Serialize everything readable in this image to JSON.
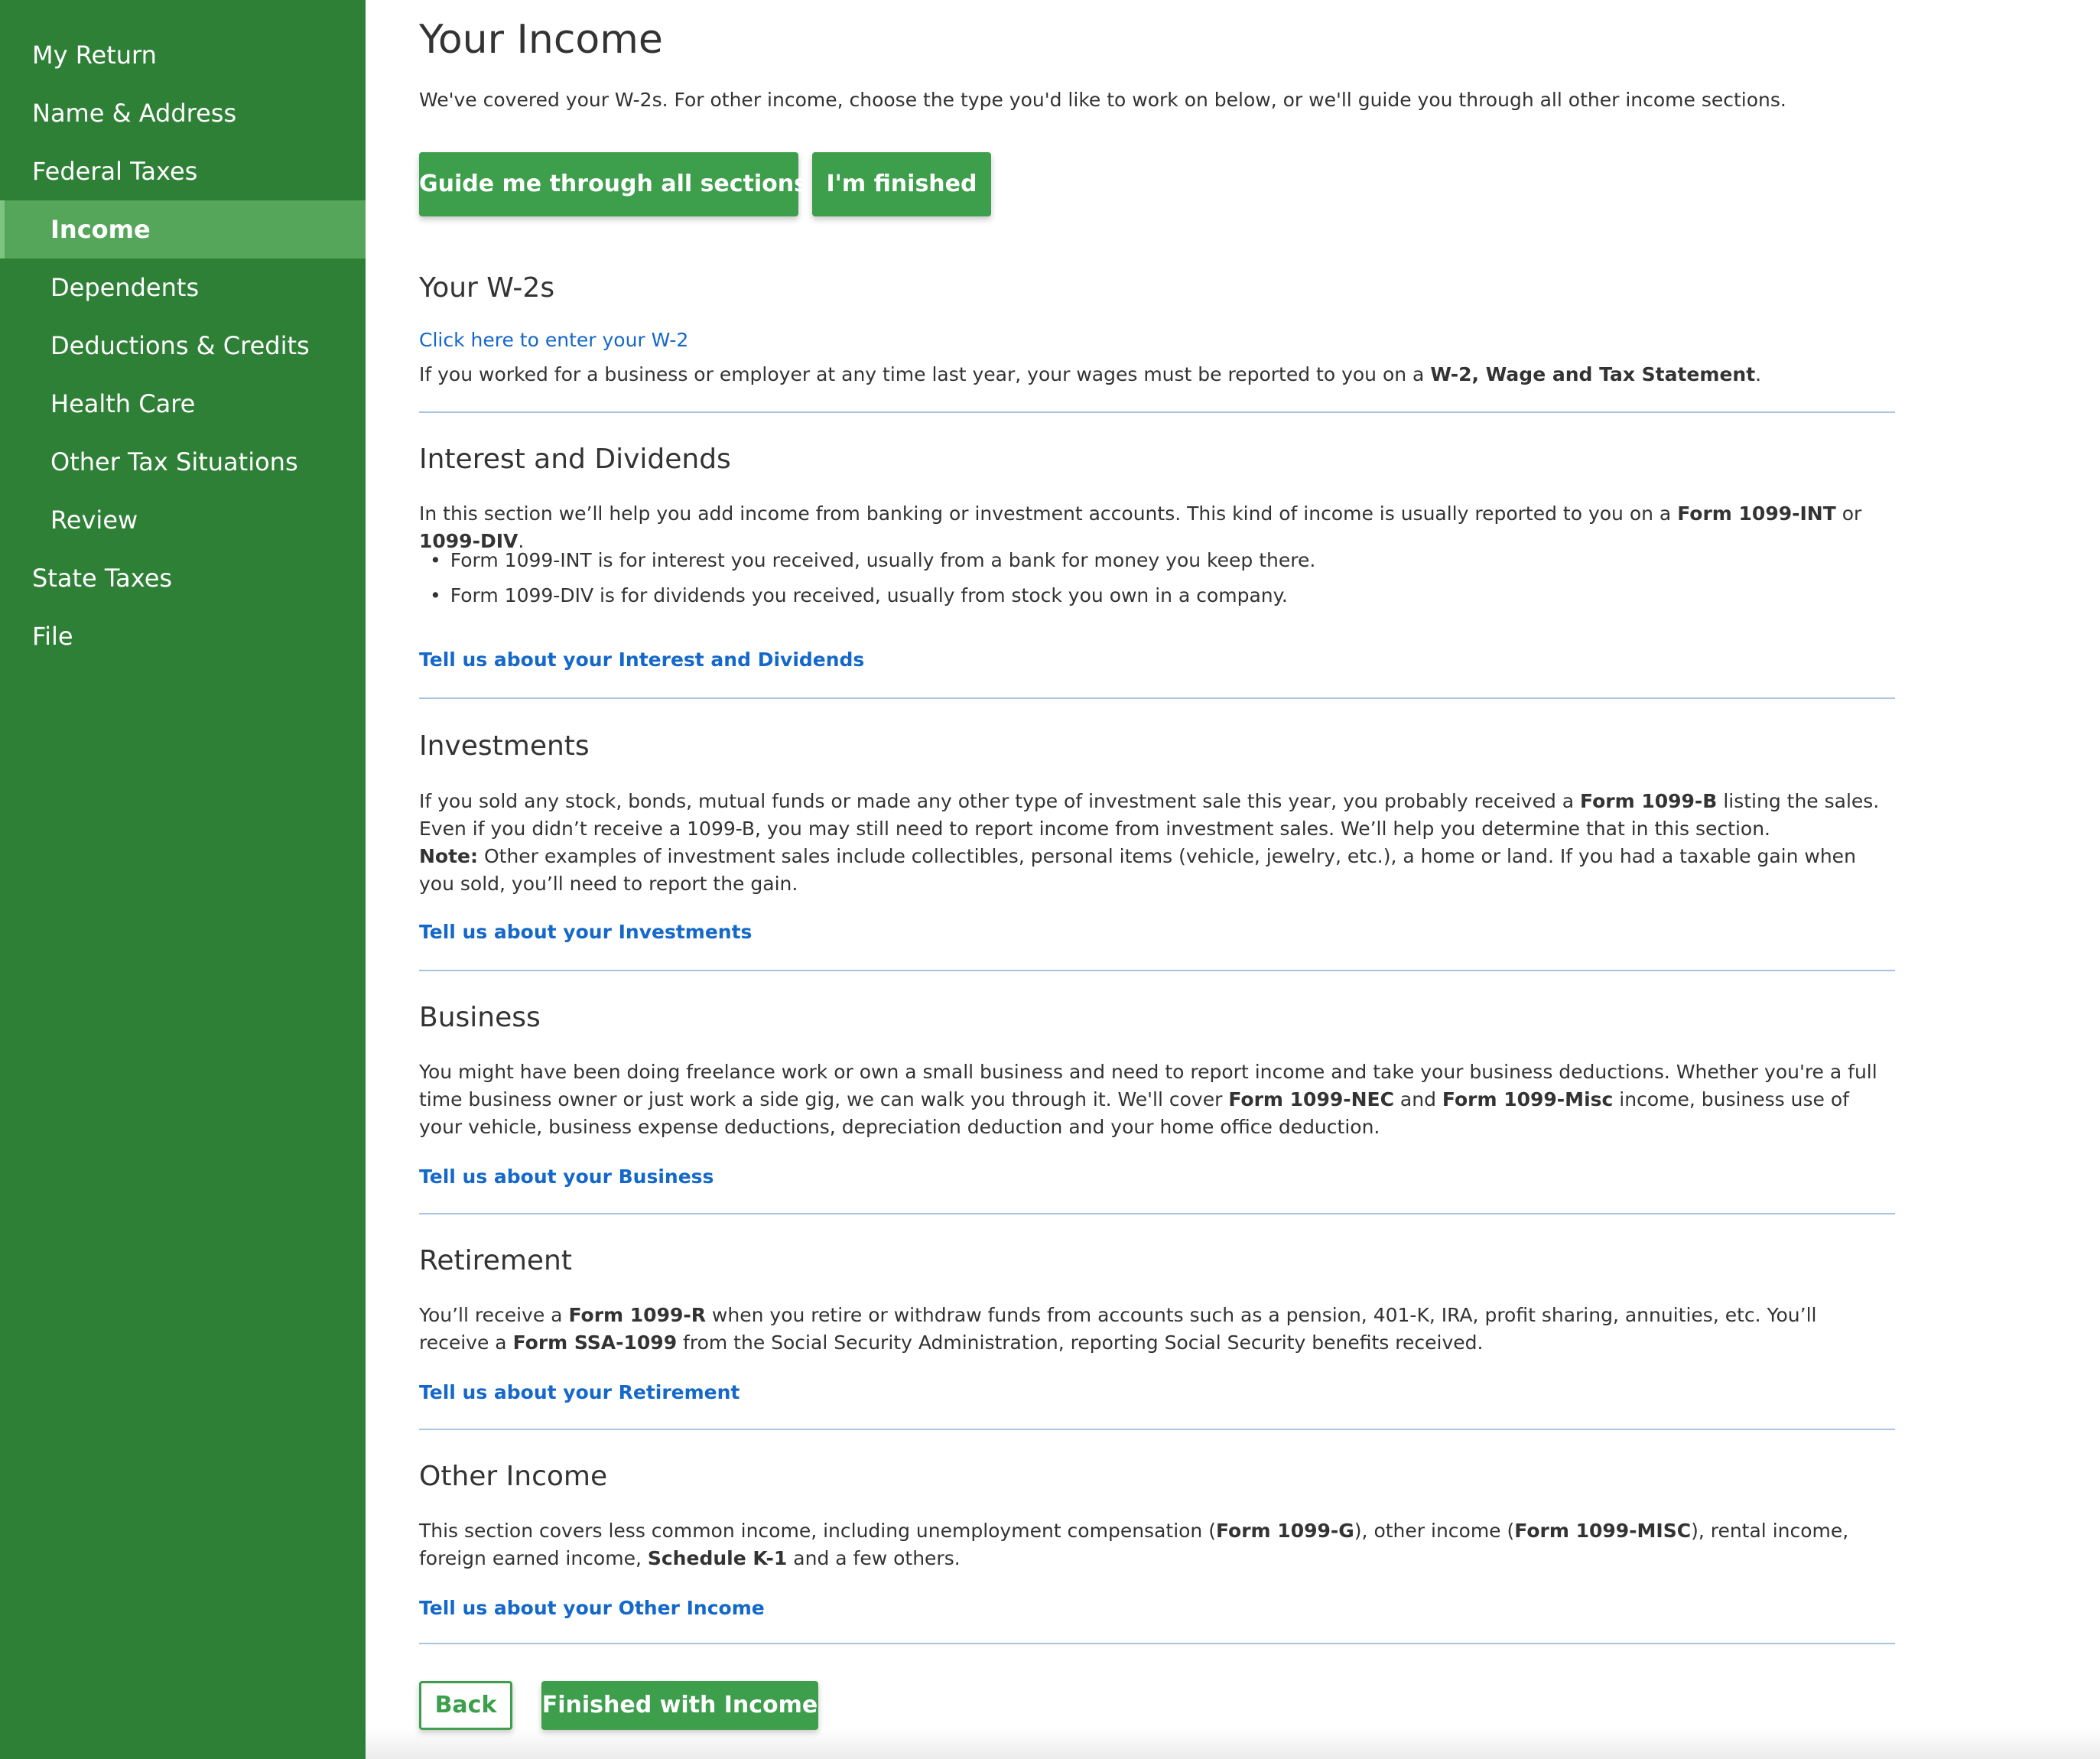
{
  "sidebar": {
    "items": [
      {
        "label": "My Return"
      },
      {
        "label": "Name & Address"
      },
      {
        "label": "Federal Taxes"
      },
      {
        "label": "Income",
        "active": true
      },
      {
        "label": "Dependents"
      },
      {
        "label": "Deductions & Credits"
      },
      {
        "label": "Health Care"
      },
      {
        "label": "Other Tax Situations"
      },
      {
        "label": "Review"
      },
      {
        "label": "State Taxes"
      },
      {
        "label": "File"
      }
    ]
  },
  "header": {
    "title": "Your Income",
    "intro": "We've covered your W-2s. For other income, choose the type you'd like to work on below, or we'll guide you through all other income sections.",
    "guide_button": "Guide me through all sections",
    "finished_button": "I'm finished"
  },
  "w2": {
    "heading": "Your W-2s",
    "link": "Click here to enter your W-2",
    "text_pre": "If you worked for a business or employer at any time last year, your wages must be reported to you on a ",
    "text_bold": "W-2, Wage and Tax Statement",
    "text_post": "."
  },
  "interest": {
    "heading": "Interest and Dividends",
    "text_pre": "In this section we’ll help you add income from banking or investment accounts. This kind of income is usually reported to you on a ",
    "bold1": "Form 1099-INT",
    "mid": " or ",
    "bold2": "1099-DIV",
    "text_post": ".",
    "bullets": [
      "Form 1099-INT is for interest you received, usually from a bank for money you keep there.",
      "Form 1099-DIV is for dividends you received, usually from stock you own in a company."
    ],
    "link": "Tell us about your Interest and Dividends"
  },
  "investments": {
    "heading": "Investments",
    "text_pre": "If you sold any stock, bonds, mutual funds or made any other type of investment sale this year, you probably received a ",
    "bold1": "Form 1099-B",
    "text_post": " listing the sales. Even if you didn’t receive a 1099-B, you may still need to report income from investment sales. We’ll help you determine that in this section.",
    "note_label": "Note:",
    "note_text": " Other examples of investment sales include collectibles, personal items (vehicle, jewelry, etc.), a home or land. If you had a taxable gain when you sold, you’ll need to report the gain.",
    "link": "Tell us about your Investments"
  },
  "business": {
    "heading": "Business",
    "text_pre": "You might have been doing freelance work or own a small business and need to report income and take your business deductions. Whether you're a full time business owner or just work a side gig, we can walk you through it. We'll cover ",
    "bold1": "Form 1099-NEC",
    "mid": " and ",
    "bold2": "Form 1099-Misc",
    "text_post": " income, business use of your vehicle, business expense deductions, depreciation deduction and your home office deduction.",
    "link": "Tell us about your Business"
  },
  "retirement": {
    "heading": "Retirement",
    "text_pre": "You’ll receive a ",
    "bold1": "Form 1099-R",
    "mid": " when you retire or withdraw funds from accounts such as a pension, 401-K, IRA, profit sharing, annuities, etc. You’ll receive a ",
    "bold2": "Form SSA-1099",
    "text_post": " from the Social Security Administration, reporting Social Security benefits received.",
    "link": "Tell us about your Retirement"
  },
  "other": {
    "heading": "Other Income",
    "text_pre": "This section covers less common income, including unemployment compensation (",
    "bold1": "Form 1099-G",
    "mid1": "), other income (",
    "bold2": "Form 1099-MISC",
    "mid2": "), rental income, foreign earned income, ",
    "bold3": "Schedule K-1",
    "text_post": " and a few others.",
    "link": "Tell us about your Other Income"
  },
  "footer": {
    "back_button": "Back",
    "finished_button": "Finished with Income"
  },
  "colors": {
    "sidebar_bg": "#2f8037",
    "sidebar_active": "#55a65a",
    "button_green": "#3d9f4b",
    "link_blue": "#1468c9",
    "divider": "#a9c3e2"
  }
}
